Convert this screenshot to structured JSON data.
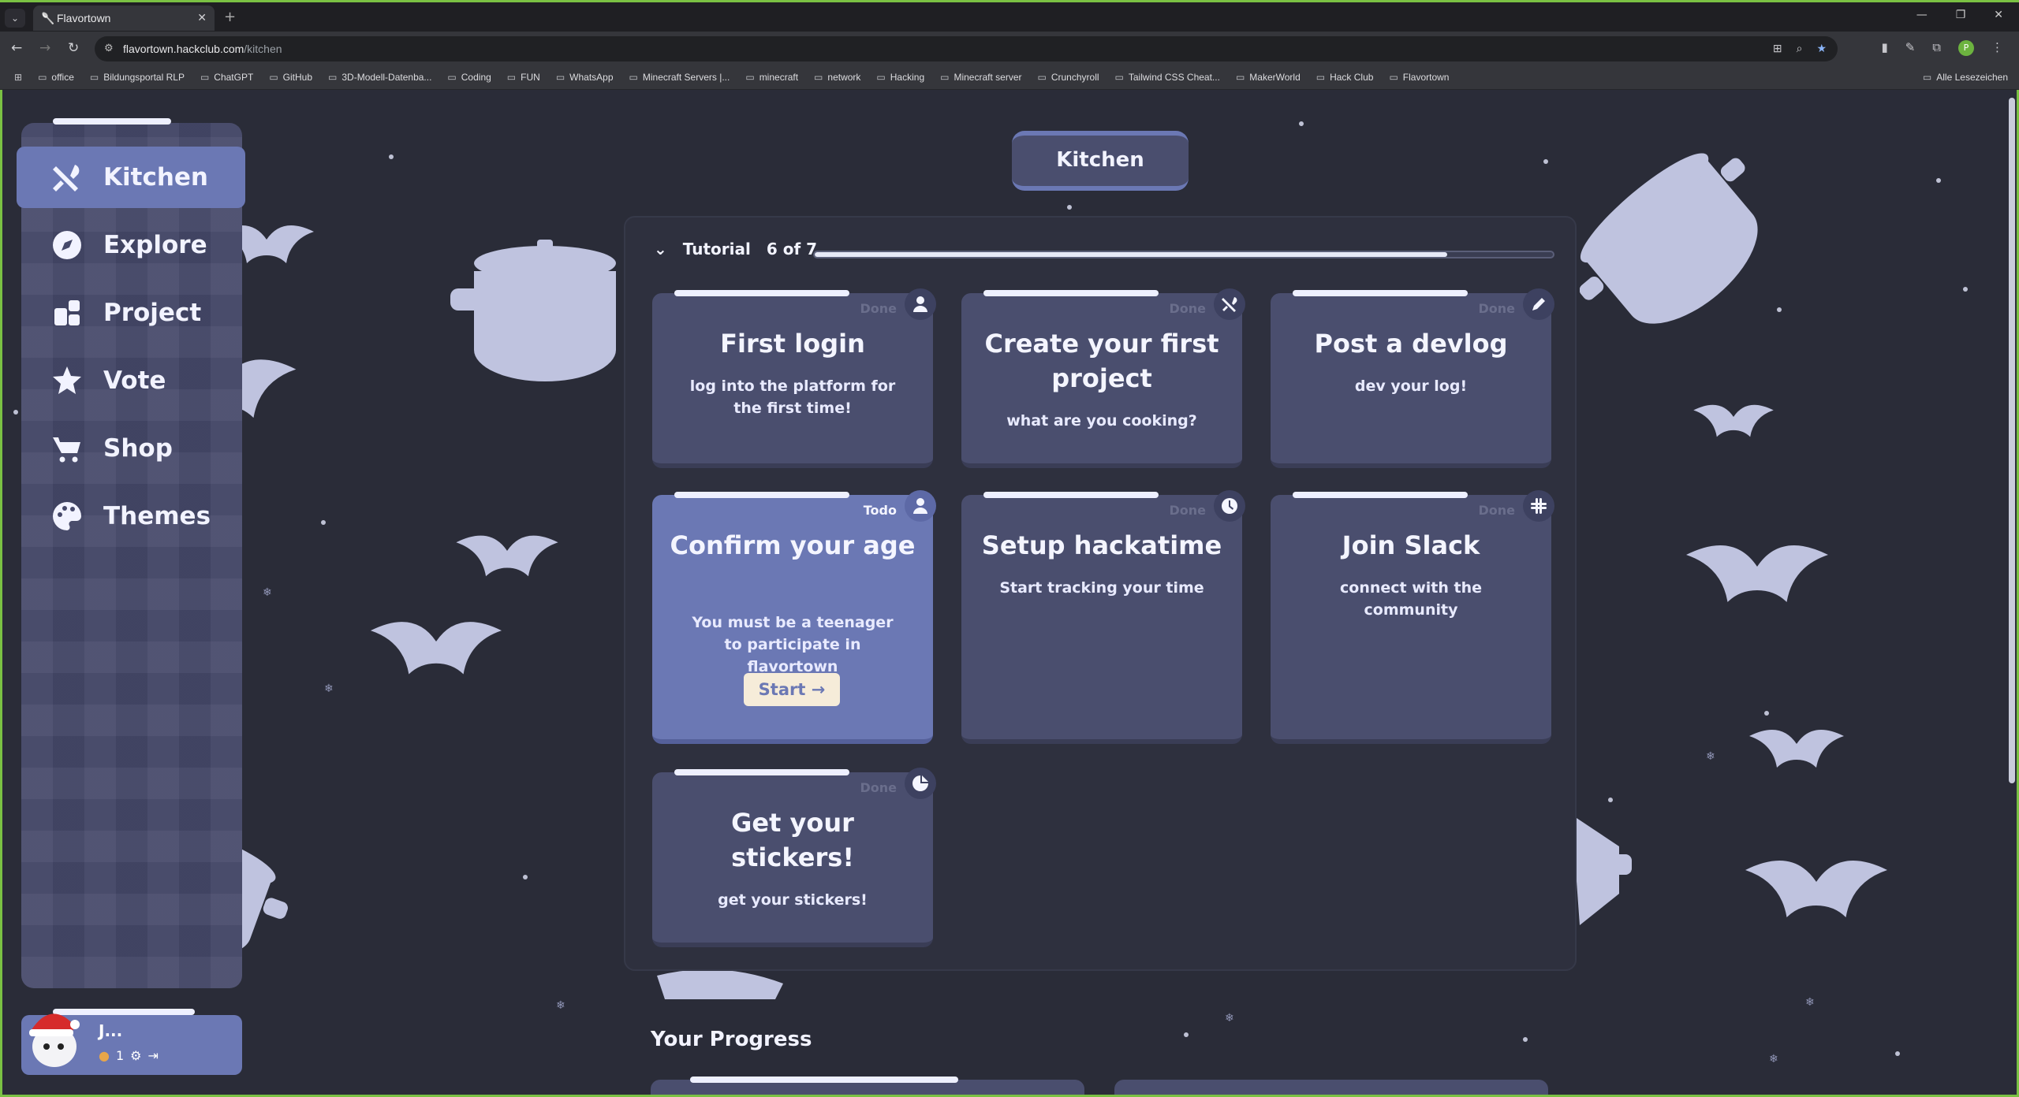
{
  "browser": {
    "tab_title": "Flavortown",
    "url_host": "flavortown.hackclub.com",
    "url_path": "/kitchen",
    "profile_initial": "P",
    "bookmarks": [
      "office",
      "Bildungsportal RLP",
      "ChatGPT",
      "GitHub",
      "3D-Modell-Datenba...",
      "Coding",
      "FUN",
      "WhatsApp",
      "Minecraft Servers |...",
      "minecraft",
      "network",
      "Hacking",
      "Minecraft server",
      "Crunchyroll",
      "Tailwind CSS Cheat...",
      "MakerWorld",
      "Hack Club",
      "Flavortown"
    ],
    "all_bookmarks": "Alle Lesezeichen"
  },
  "sidebar": {
    "items": [
      {
        "label": "Kitchen"
      },
      {
        "label": "Explore"
      },
      {
        "label": "Project"
      },
      {
        "label": "Vote"
      },
      {
        "label": "Shop"
      },
      {
        "label": "Themes"
      }
    ]
  },
  "user": {
    "name": "J...",
    "cookies": "1"
  },
  "header": {
    "title": "Kitchen"
  },
  "tutorial": {
    "label": "Tutorial",
    "step": "6 of 7",
    "progress": 0.857,
    "cards": [
      {
        "status": "Done",
        "title": "First login",
        "desc": "log into the platform for the first time!",
        "icon": "user-icon"
      },
      {
        "status": "Done",
        "title": "Create your first project",
        "desc": "what are you cooking?",
        "icon": "utensils-icon"
      },
      {
        "status": "Done",
        "title": "Post a devlog",
        "desc": "dev your log!",
        "icon": "pencil-icon"
      },
      {
        "status": "Todo",
        "title": "Confirm your age",
        "desc": "You must be a teenager to participate in flavortown",
        "icon": "user-icon",
        "button": "Start →"
      },
      {
        "status": "Done",
        "title": "Setup hackatime",
        "desc": "Start tracking your time",
        "icon": "clock-icon"
      },
      {
        "status": "Done",
        "title": "Join Slack",
        "desc": "connect with the community",
        "icon": "slack-icon"
      },
      {
        "status": "Done",
        "title": "Get your stickers!",
        "desc": "get your stickers!",
        "icon": "sticker-icon"
      }
    ]
  },
  "progress_section": {
    "title": "Your Progress"
  },
  "colors": {
    "accent": "#6b78b4",
    "card": "#4a4e6e",
    "background": "#2a2c38",
    "browser_frame": "#7ac143"
  }
}
